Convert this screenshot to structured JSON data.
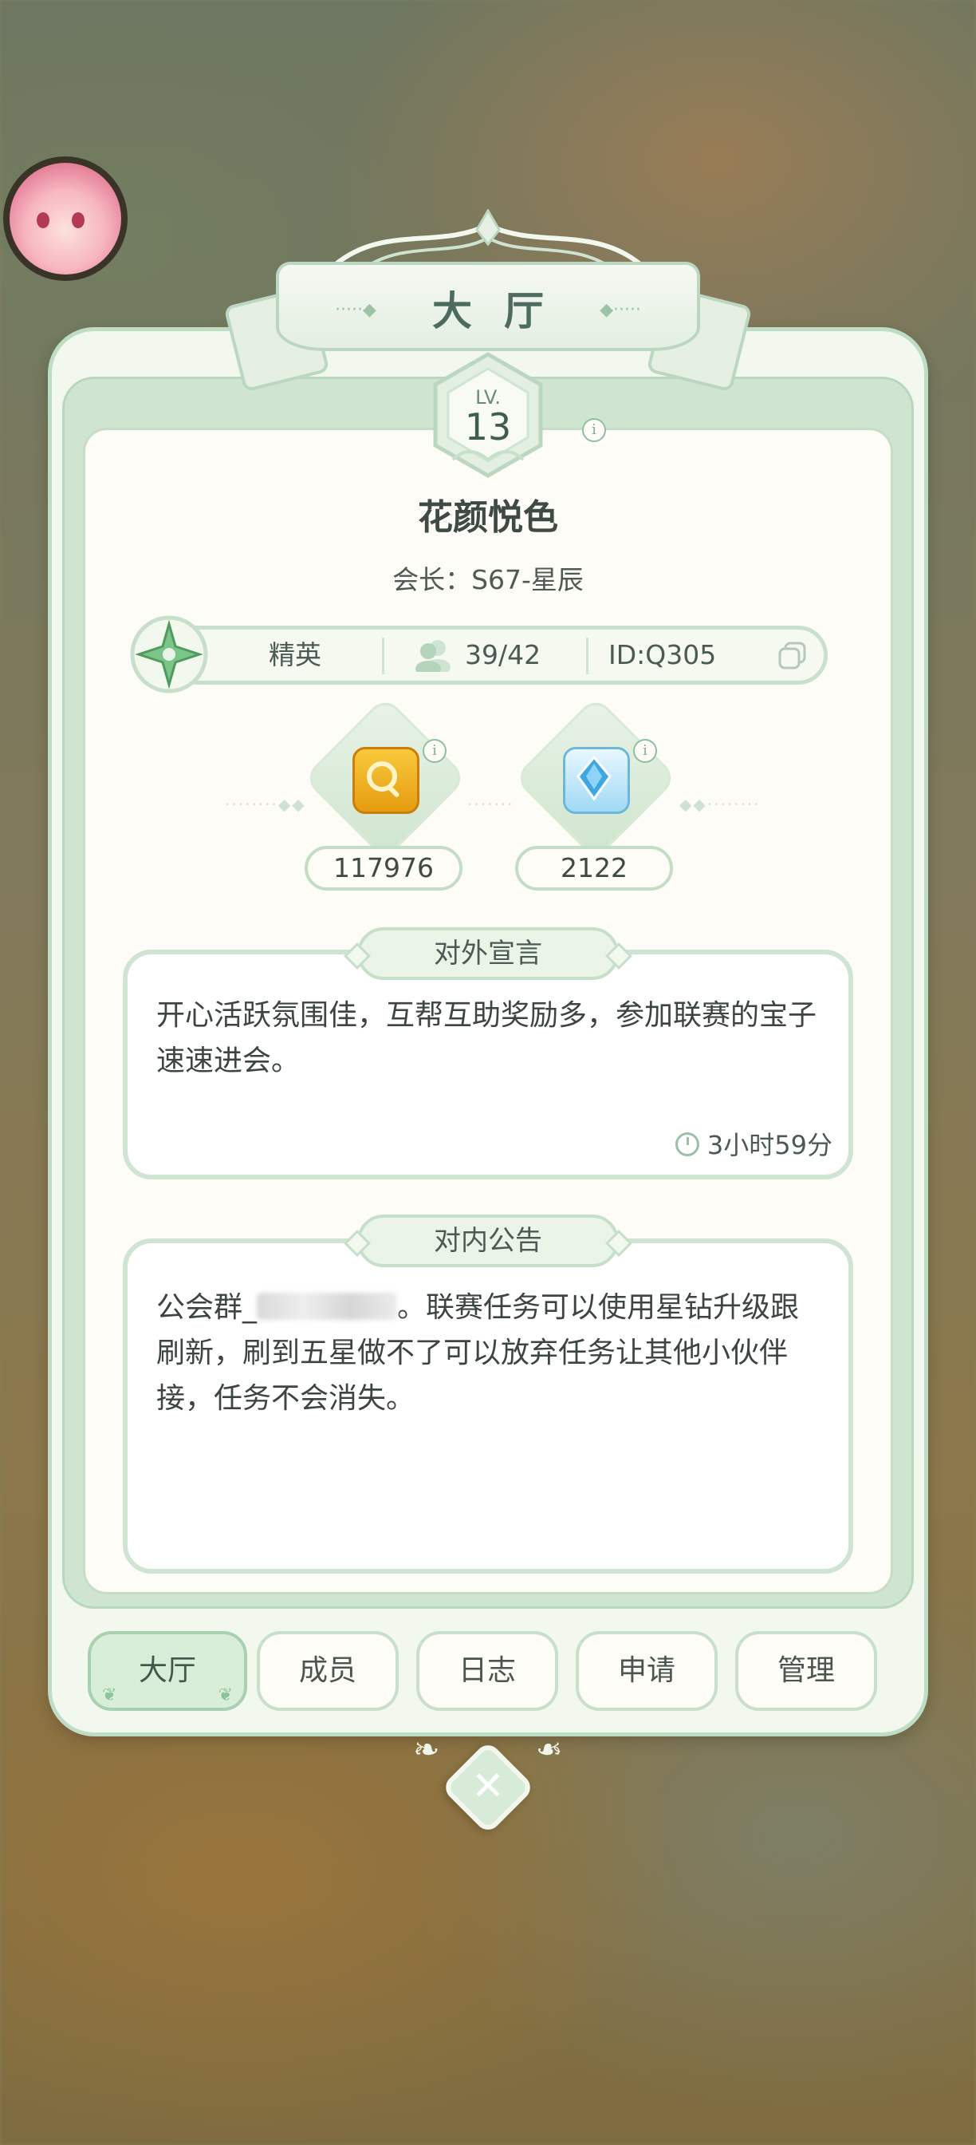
{
  "header": {
    "title": "大厅"
  },
  "guild": {
    "level_label": "LV.",
    "level": "13",
    "name": "花颜悦色",
    "leader": "会长：S67-星辰",
    "rank": "精英",
    "members": "39/42",
    "id": "ID:Q305"
  },
  "resources": [
    {
      "value": "117976",
      "icon": "gold-coin-icon",
      "color": "#f2b418"
    },
    {
      "value": "2122",
      "icon": "blue-gem-icon",
      "color": "#4fb6e8"
    }
  ],
  "declaration": {
    "title": "对外宣言",
    "text": "开心活跃氛围佳，互帮互助奖励多，参加联赛的宝子速速进会。",
    "time": "3小时59分"
  },
  "notice": {
    "title": "对内公告",
    "text_prefix": "公会群_",
    "text_suffix": "。联赛任务可以使用星钻升级跟刷新，刷到五星做不了可以放弃任务让其他小伙伴接，任务不会消失。"
  },
  "tabs": [
    {
      "label": "大厅",
      "active": true
    },
    {
      "label": "成员"
    },
    {
      "label": "日志"
    },
    {
      "label": "申请"
    },
    {
      "label": "管理"
    }
  ],
  "colors": {
    "accent_green": "#cfe5d2",
    "border_green": "#bfdcc4",
    "text_dark": "#3f4a45"
  }
}
